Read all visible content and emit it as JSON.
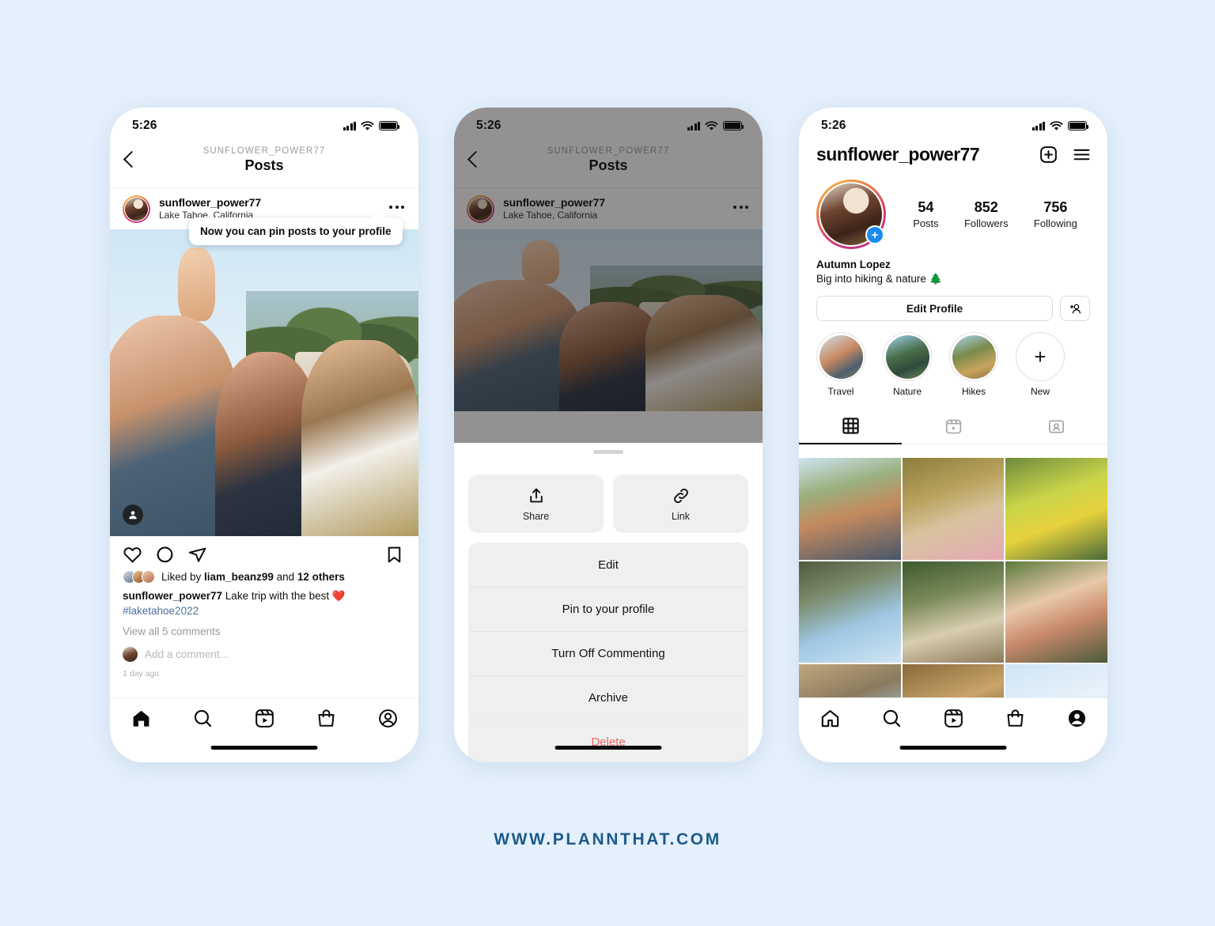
{
  "background_color": "#e4f0fc",
  "footer": {
    "text": "WWW.PLANNTHAT.COM",
    "color": "#1d5a8a"
  },
  "phone1": {
    "status": {
      "time": "5:26"
    },
    "header": {
      "subtitle": "SUNFLOWER_POWER77",
      "title": "Posts",
      "back_icon": "chevron-left-icon"
    },
    "post": {
      "username": "sunflower_power77",
      "location": "Lake Tahoe, California",
      "more_icon": "more-options-icon",
      "tag_icon": "tag-people-icon"
    },
    "tooltip": {
      "text": "Now you can pin posts to your profile"
    },
    "actions": {
      "like_icon": "heart-icon",
      "comment_icon": "comment-icon",
      "share_icon": "send-icon",
      "save_icon": "bookmark-icon"
    },
    "likes": {
      "prefix": "Liked by ",
      "user": "liam_beanz99",
      "middle": " and ",
      "others": "12 others"
    },
    "caption": {
      "username": "sunflower_power77",
      "text": " Lake trip with the best ",
      "emoji": "❤️",
      "hashtag": "#laketahoe2022"
    },
    "view_comments": "View all 5 comments",
    "add_comment_placeholder": "Add a comment...",
    "timestamp": "1 day ago",
    "bottom_nav": [
      "home-icon",
      "search-icon",
      "reels-icon",
      "shop-icon",
      "profile-icon"
    ]
  },
  "phone2": {
    "status": {
      "time": "5:26"
    },
    "header": {
      "subtitle": "SUNFLOWER_POWER77",
      "title": "Posts",
      "back_icon": "chevron-left-icon"
    },
    "post": {
      "username": "sunflower_power77",
      "location": "Lake Tahoe, California",
      "more_icon": "more-options-icon"
    },
    "sheet": {
      "share_label": "Share",
      "share_icon": "share-up-icon",
      "link_label": "Link",
      "link_icon": "link-icon",
      "items": [
        {
          "label": "Edit",
          "danger": false
        },
        {
          "label": "Pin to your profile",
          "danger": false
        },
        {
          "label": "Turn Off Commenting",
          "danger": false
        },
        {
          "label": "Archive",
          "danger": false
        },
        {
          "label": "Delete",
          "danger": true
        }
      ],
      "delete_color": "#ed6a63"
    }
  },
  "phone3": {
    "status": {
      "time": "5:26"
    },
    "username": "sunflower_power77",
    "header_icons": {
      "add": "plus-square-icon",
      "menu": "hamburger-menu-icon"
    },
    "avatar_badge": "+",
    "stats": [
      {
        "value": "54",
        "label": "Posts"
      },
      {
        "value": "852",
        "label": "Followers"
      },
      {
        "value": "756",
        "label": "Following"
      }
    ],
    "name": "Autumn Lopez",
    "bio": "Big into hiking & nature 🌲",
    "edit_profile_label": "Edit Profile",
    "add_person_icon": "add-person-icon",
    "highlights": [
      {
        "label": "Travel",
        "icon": "highlight-travel"
      },
      {
        "label": "Nature",
        "icon": "highlight-nature"
      },
      {
        "label": "Hikes",
        "icon": "highlight-hikes"
      },
      {
        "label": "New",
        "icon": "plus-icon"
      }
    ],
    "tabs": [
      {
        "icon": "grid-icon",
        "active": true
      },
      {
        "icon": "reels-icon",
        "active": false
      },
      {
        "icon": "tagged-icon",
        "active": false
      }
    ],
    "bottom_nav": [
      "home-icon",
      "search-icon",
      "reels-icon",
      "shop-icon",
      "profile-filled-icon"
    ]
  }
}
